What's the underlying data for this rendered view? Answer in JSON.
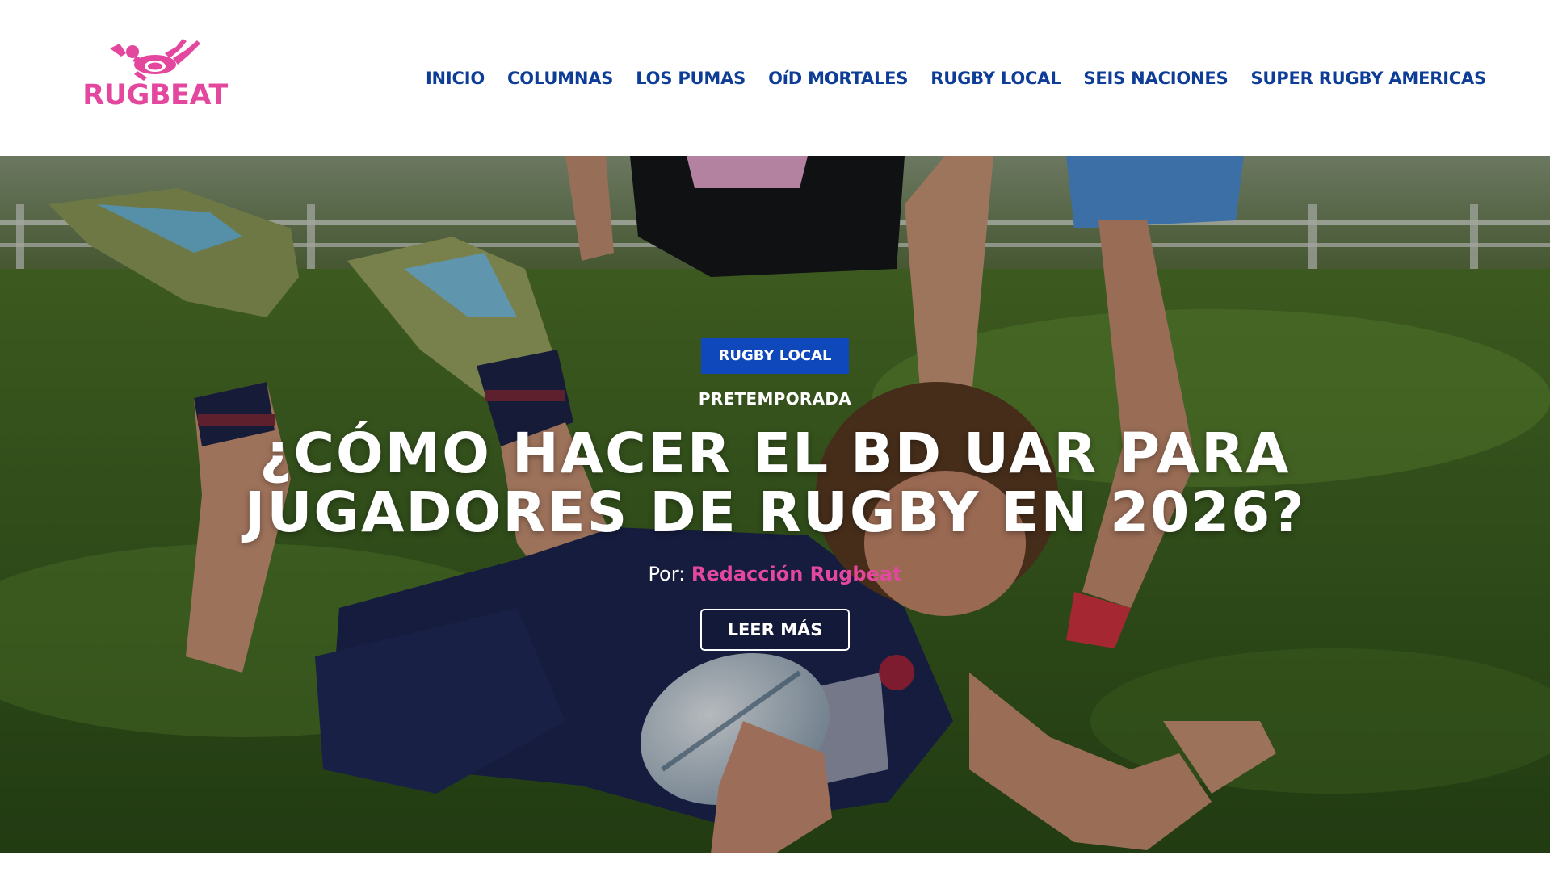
{
  "brand": {
    "logo_text": "RUGBEAT",
    "logo_icon": "diving-rugby-player-icon",
    "primary_color": "#e4489e",
    "nav_color": "#0e3d97",
    "badge_color": "#0f48ba"
  },
  "nav": {
    "items": [
      {
        "label": "INICIO"
      },
      {
        "label": "COLUMNAS"
      },
      {
        "label": "LOS PUMAS"
      },
      {
        "label": "OíD MORTALES"
      },
      {
        "label": "RUGBY LOCAL"
      },
      {
        "label": "SEIS NACIONES"
      },
      {
        "label": "SUPER RUGBY AMERICAS"
      }
    ]
  },
  "hero": {
    "category": "RUGBY LOCAL",
    "kicker": "PRETEMPORADA",
    "title": "¿CÓMO HACER EL BD UAR PARA JUGADORES DE RUGBY EN 2026?",
    "byline_prefix": "Por:",
    "author": "Redacción Rugbeat",
    "cta_label": "LEER MÁS",
    "image_description_icon": "rugby-player-diving-try-photo"
  }
}
